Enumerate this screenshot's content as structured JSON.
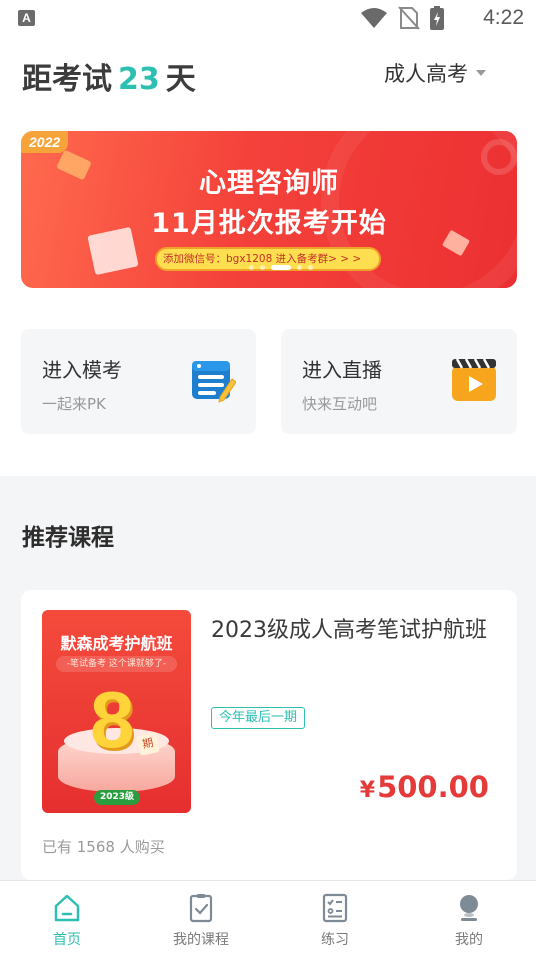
{
  "status_bar": {
    "app_icon_letter": "A",
    "time": "4:22",
    "icons": [
      "wifi-icon",
      "no-sim-icon",
      "battery-charging-icon"
    ]
  },
  "header": {
    "countdown_prefix": "距考试",
    "countdown_days": "23",
    "countdown_suffix": "天",
    "exam_type": "成人高考"
  },
  "banner": {
    "year_tag": "2022",
    "title_line1": "心理咨询师",
    "title_line2": "11月批次报考开始",
    "pill_text": "添加微信号：bgx1208 进入备考群>  >  >",
    "slide_count": 5,
    "active_slide": 2
  },
  "entries": [
    {
      "title": "进入模考",
      "subtitle": "一起来PK",
      "icon": "exam-list-icon"
    },
    {
      "title": "进入直播",
      "subtitle": "快来互动吧",
      "icon": "video-play-icon"
    }
  ],
  "recommend": {
    "section_title": "推荐课程",
    "course": {
      "cover_title": "默森成考护航班",
      "cover_subtitle": "-笔试备考 这个课就够了-",
      "cover_number": "8",
      "cover_unit": "期",
      "cover_year": "2023级",
      "name": "2023级成人高考笔试护航班",
      "tag": "今年最后一期",
      "price_symbol": "¥",
      "price": "500.00",
      "buyers": "已有 1568 人购买"
    }
  },
  "tabbar": {
    "active": 0,
    "tabs": [
      {
        "label": "首页",
        "icon": "home-icon"
      },
      {
        "label": "我的课程",
        "icon": "my-courses-icon"
      },
      {
        "label": "练习",
        "icon": "practice-icon"
      },
      {
        "label": "我的",
        "icon": "profile-icon"
      }
    ]
  },
  "colors": {
    "accent": "#2cbfb2",
    "price": "#e43b3a",
    "banner_red": "#f4413a"
  }
}
